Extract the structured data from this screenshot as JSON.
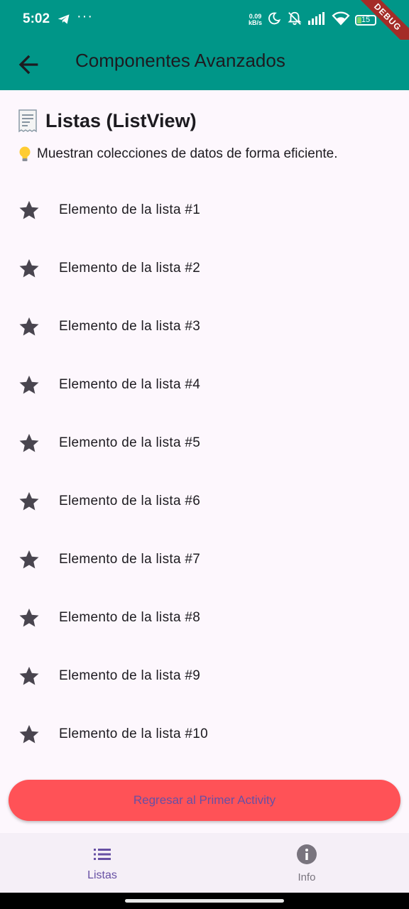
{
  "status_bar": {
    "time": "5:02",
    "net_speed_value": "0.09",
    "net_speed_unit": "kB/s",
    "battery": "15",
    "debug_banner": "DEBUG"
  },
  "app_bar": {
    "title": "Componentes Avanzados",
    "back_icon": "arrow-back-icon"
  },
  "section": {
    "title_emoji": "receipt-icon",
    "title": "Listas (ListView)",
    "description_emoji": "light-bulb-icon",
    "description": "Muestran colecciones de datos de forma eficiente."
  },
  "list": {
    "icon": "star-icon",
    "items": [
      {
        "label": "Elemento de la lista #1"
      },
      {
        "label": "Elemento de la lista #2"
      },
      {
        "label": "Elemento de la lista #3"
      },
      {
        "label": "Elemento de la lista #4"
      },
      {
        "label": "Elemento de la lista #5"
      },
      {
        "label": "Elemento de la lista #6"
      },
      {
        "label": "Elemento de la lista #7"
      },
      {
        "label": "Elemento de la lista #8"
      },
      {
        "label": "Elemento de la lista #9"
      },
      {
        "label": "Elemento de la lista #10"
      }
    ]
  },
  "return_button": {
    "label": "Regresar al Primer Activity"
  },
  "bottom_nav": {
    "items": [
      {
        "label": "Listas",
        "icon": "list-icon",
        "selected": true
      },
      {
        "label": "Info",
        "icon": "info-icon",
        "selected": false
      }
    ]
  },
  "colors": {
    "app_bar": "#009688",
    "background": "#fdf7fd",
    "button": "#ff5257",
    "accent": "#6750a4"
  }
}
